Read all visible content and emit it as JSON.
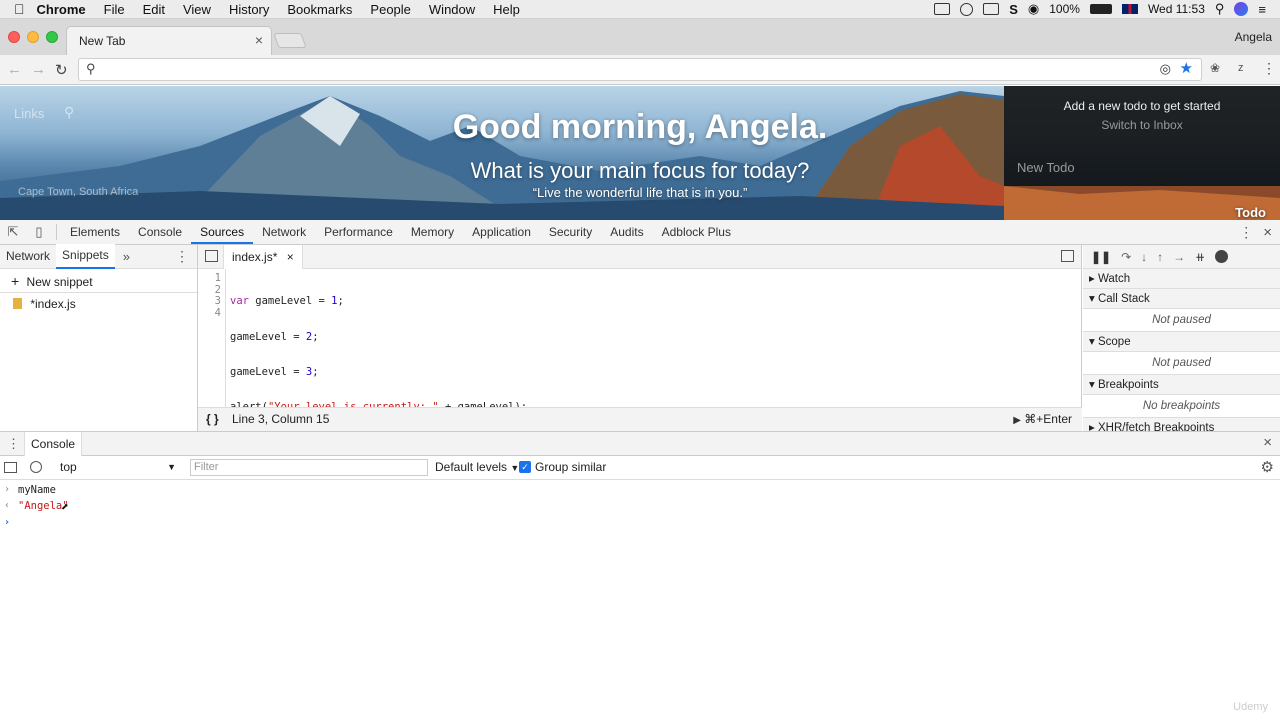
{
  "menubar": {
    "app": "Chrome",
    "items": [
      "File",
      "Edit",
      "View",
      "History",
      "Bookmarks",
      "People",
      "Window",
      "Help"
    ],
    "battery": "100%",
    "clock": "Wed 11:53"
  },
  "browser": {
    "tab_title": "New Tab",
    "profile": "Angela",
    "omnibox_value": ""
  },
  "page": {
    "links": "Links",
    "greeting": "Good morning, Angela.",
    "focus": "What is your main focus for today?",
    "quote": "“Live the wonderful life that is in you.”",
    "location": "Cape Town, South Africa",
    "todo_add": "Add a new todo to get started",
    "todo_switch": "Switch to Inbox",
    "todo_new": "New Todo",
    "todo_label": "Todo"
  },
  "devtools": {
    "tabs": [
      "Elements",
      "Console",
      "Sources",
      "Network",
      "Performance",
      "Memory",
      "Application",
      "Security",
      "Audits",
      "Adblock Plus"
    ],
    "active_tab": "Sources",
    "navigator": {
      "tabs": [
        "Network",
        "Snippets"
      ],
      "new_snippet": "New snippet",
      "snippet_file": "*index.js"
    },
    "editor": {
      "file_tab": "index.js*",
      "line_numbers": [
        "1",
        "2",
        "3",
        "4"
      ],
      "code_lines": [
        {
          "kw": "var",
          "rest": " gameLevel = ",
          "num": "1",
          "end": ";"
        },
        {
          "kw": "",
          "rest": "gameLevel = ",
          "num": "2",
          "end": ";"
        },
        {
          "kw": "",
          "rest": "gameLevel = ",
          "num": "3",
          "end": ";"
        },
        {
          "kw": "",
          "rest": "alert(",
          "str": "\"Your level is currently: \"",
          "end": " + gameLevel);"
        }
      ],
      "status": "Line 3, Column 15",
      "run_hint": "⌘+Enter",
      "format_icon": "{ }"
    },
    "debugger": {
      "sections": [
        "Watch",
        "Call Stack",
        "Scope",
        "Breakpoints",
        "XHR/fetch Breakpoints"
      ],
      "not_paused": "Not paused",
      "no_breakpoints": "No breakpoints"
    },
    "drawer": {
      "tab": "Console",
      "context": "top",
      "filter_placeholder": "Filter",
      "levels": "Default levels",
      "group_similar": "Group similar"
    },
    "console": {
      "input": "myName",
      "output": "\"Angela\""
    }
  },
  "watermark": "Udemy"
}
